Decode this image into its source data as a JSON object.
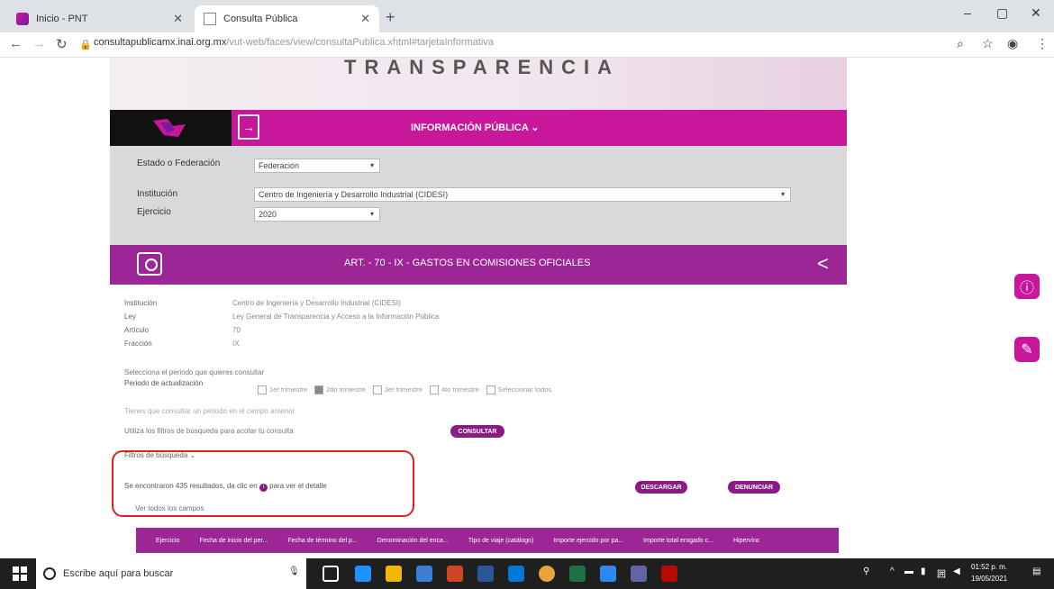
{
  "browser": {
    "tabs": [
      {
        "label": "Inicio - PNT",
        "active": false
      },
      {
        "label": "Consulta Pública",
        "active": true
      }
    ],
    "url_host": "consultapublicamx.inai.org.mx",
    "url_path": "/vut-web/faces/view/consultaPublica.xhtml#tarjetaInformativa"
  },
  "hero": {
    "title": "TRANSPARENCIA"
  },
  "nav": {
    "menu_label": "INFORMACIÓN PÚBLICA ⌄"
  },
  "filters": {
    "estado_label": "Estado o Federación",
    "estado_value": "Federación",
    "institucion_label": "Institución",
    "institucion_value": "Centro de Ingeniería y Desarrollo Industrial (CIDESI)",
    "ejercicio_label": "Ejercicio",
    "ejercicio_value": "2020"
  },
  "section": {
    "title": "ART. - 70 - IX - GASTOS EN COMISIONES OFICIALES"
  },
  "details": {
    "institucion_label": "Institución",
    "institucion_value": "Centro de Ingeniería y Desarrollo Industrial (CIDESI)",
    "ley_label": "Ley",
    "ley_value": "Ley General de Transparencia y Acceso a la Información Pública",
    "articulo_label": "Artículo",
    "articulo_value": "70",
    "fraccion_label": "Fracción",
    "fraccion_value": "IX"
  },
  "periodo": {
    "prompt": "Selecciona el periodo que quieres consultar",
    "label": "Periodo de actualización",
    "options": [
      "1er trimestre",
      "2do trimestre",
      "3er trimestre",
      "4to trimestre",
      "Seleccionar todos"
    ]
  },
  "texts": {
    "periodo_hint": "Tienes que consultar un periodo en el campo anterior",
    "filtros_hint": "Utiliza los filtros de búsqueda para acotar tu consulta",
    "filtros_toggle": "Filtros de búsqueda ⌄",
    "results": "Se encontraron 435 resultados, da clic en",
    "results_tail": "para ver el detalle",
    "ver_todos": "Ver todos los campos"
  },
  "buttons": {
    "consultar": "CONSULTAR",
    "descargar": "DESCARGAR",
    "denunciar": "DENUNCIAR"
  },
  "table_columns": [
    "Ejercicio",
    "Fecha de inicio del per...",
    "Fecha de término del p...",
    "Denominación del enca...",
    "Tipo de viaje (catálogo)",
    "Importe ejercido por pa...",
    "Importe total erogado c...",
    "Hipervínc"
  ],
  "taskbar": {
    "search_placeholder": "Escribe aquí para buscar",
    "time": "01:52 p. m.",
    "date": "19/05/2021"
  },
  "colors": {
    "pink": "#c8179b",
    "purple": "#9c2696",
    "highlight_box": "#e02020"
  }
}
